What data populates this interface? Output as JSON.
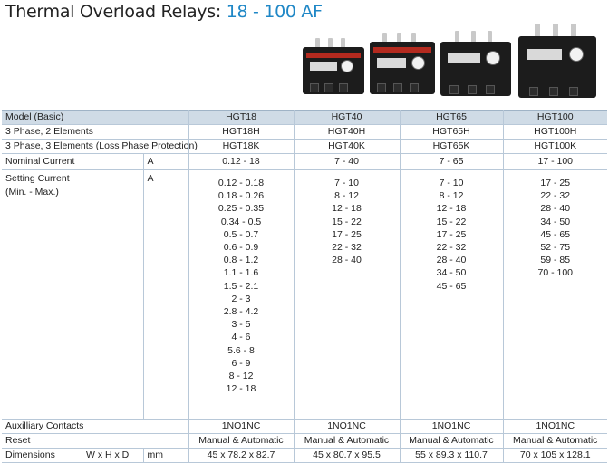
{
  "header": {
    "title_prefix": "Thermal Overload Relays:",
    "title_range": "18 - 100 AF"
  },
  "products": [
    {
      "name": "HGT18-image"
    },
    {
      "name": "HGT40-image"
    },
    {
      "name": "HGT65-image"
    },
    {
      "name": "HGT100-image"
    }
  ],
  "table": {
    "head": {
      "label": "Model (Basic)",
      "models": [
        "HGT18",
        "HGT40",
        "HGT65",
        "HGT100"
      ]
    },
    "rows": {
      "two_elements": {
        "label": "3 Phase, 2 Elements",
        "values": [
          "HGT18H",
          "HGT40H",
          "HGT65H",
          "HGT100H"
        ]
      },
      "three_elements": {
        "label": "3 Phase, 3 Elements (Loss Phase Protection)",
        "values": [
          "HGT18K",
          "HGT40K",
          "HGT65K",
          "HGT100K"
        ]
      },
      "nominal": {
        "label": "Nominal Current",
        "unit": "A",
        "values": [
          "0.12 - 18",
          "7 - 40",
          "7 - 65",
          "17 - 100"
        ]
      },
      "setting": {
        "label_1": "Setting Current",
        "label_2": "(Min. - Max.)",
        "unit": "A",
        "hgt18": [
          "0.12 - 0.18",
          "0.18 - 0.26",
          "0.25 - 0.35",
          "0.34 - 0.5",
          "0.5 - 0.7",
          "0.6 - 0.9",
          "0.8 - 1.2",
          "1.1 - 1.6",
          "1.5 - 2.1",
          "2 - 3",
          "2.8 - 4.2",
          "3 - 5",
          "4 - 6",
          "5.6 - 8",
          "6 - 9",
          "8 - 12",
          "12 - 18"
        ],
        "hgt40": [
          "7 - 10",
          "8 - 12",
          "12 - 18",
          "15 - 22",
          "17 - 25",
          "22 - 32",
          "28 - 40"
        ],
        "hgt65": [
          "7 - 10",
          "8 - 12",
          "12 - 18",
          "15 - 22",
          "17 - 25",
          "22 - 32",
          "28 - 40",
          "34 - 50",
          "45 - 65"
        ],
        "hgt100": [
          "17 - 25",
          "22 - 32",
          "28 - 40",
          "34 - 50",
          "45 - 65",
          "52 - 75",
          "59 - 85",
          "70 - 100"
        ]
      },
      "aux": {
        "label": "Auxilliary Contacts",
        "values": [
          "1NO1NC",
          "1NO1NC",
          "1NO1NC",
          "1NO1NC"
        ]
      },
      "reset": {
        "label": "Reset",
        "values": [
          "Manual & Automatic",
          "Manual & Automatic",
          "Manual & Automatic",
          "Manual & Automatic"
        ]
      },
      "dimensions": {
        "label": "Dimensions",
        "sub": "W x H x D",
        "unit": "mm",
        "values": [
          "45 x 78.2 x 82.7",
          "45 x 80.7 x 95.5",
          "55 x 89.3 x 110.7",
          "70 x 105 x 128.1"
        ]
      }
    }
  },
  "colors": {
    "accent": "#1f87c6",
    "header_bg": "#cfdbe6",
    "grid": "#b8c8d8",
    "relay_red": "#b42a1f"
  }
}
